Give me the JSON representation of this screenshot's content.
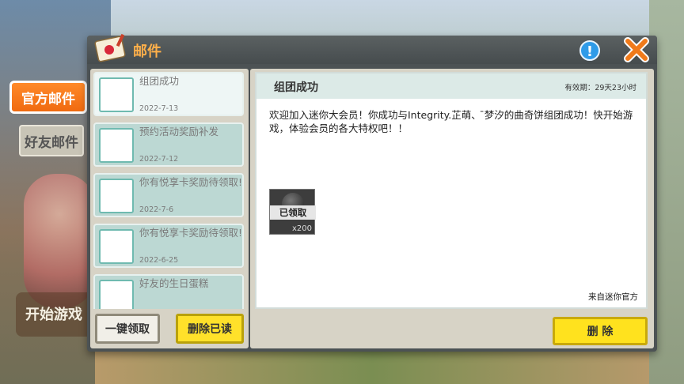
{
  "background": {
    "start_game_label": "开始游戏"
  },
  "side_tabs": {
    "official": "官方邮件",
    "friends": "好友邮件"
  },
  "modal": {
    "title": "邮件",
    "info_icon": "info-icon",
    "close_icon": "close-icon"
  },
  "mail_list": {
    "items": [
      {
        "title": "组团成功",
        "date": "2022-7-13"
      },
      {
        "title": "预约活动奖励补发",
        "date": "2022-7-12"
      },
      {
        "title": "你有悦享卡奖励待领取!",
        "date": "2022-7-6"
      },
      {
        "title": "你有悦享卡奖励待领取!",
        "date": "2022-6-25"
      },
      {
        "title": "好友的生日蛋糕",
        "date": ""
      }
    ],
    "claim_all_label": "一键领取",
    "delete_read_label": "删除已读"
  },
  "detail": {
    "title": "组团成功",
    "expiry": "有效期：29天23小时",
    "body": "欢迎加入迷你大会员！你成功与Integrity.芷萌、 ̄梦汐的曲奇饼组团成功！快开始游戏，体验会员的各大特权吧！！",
    "reward_status": "已领取",
    "reward_quantity": "x200",
    "sender": "来自迷你官方",
    "delete_label": "删 除"
  },
  "colors": {
    "accent_orange": "#f06a10",
    "title_orange": "#ffb04a",
    "button_yellow": "#ffe12a",
    "info_blue": "#2f9be8"
  }
}
